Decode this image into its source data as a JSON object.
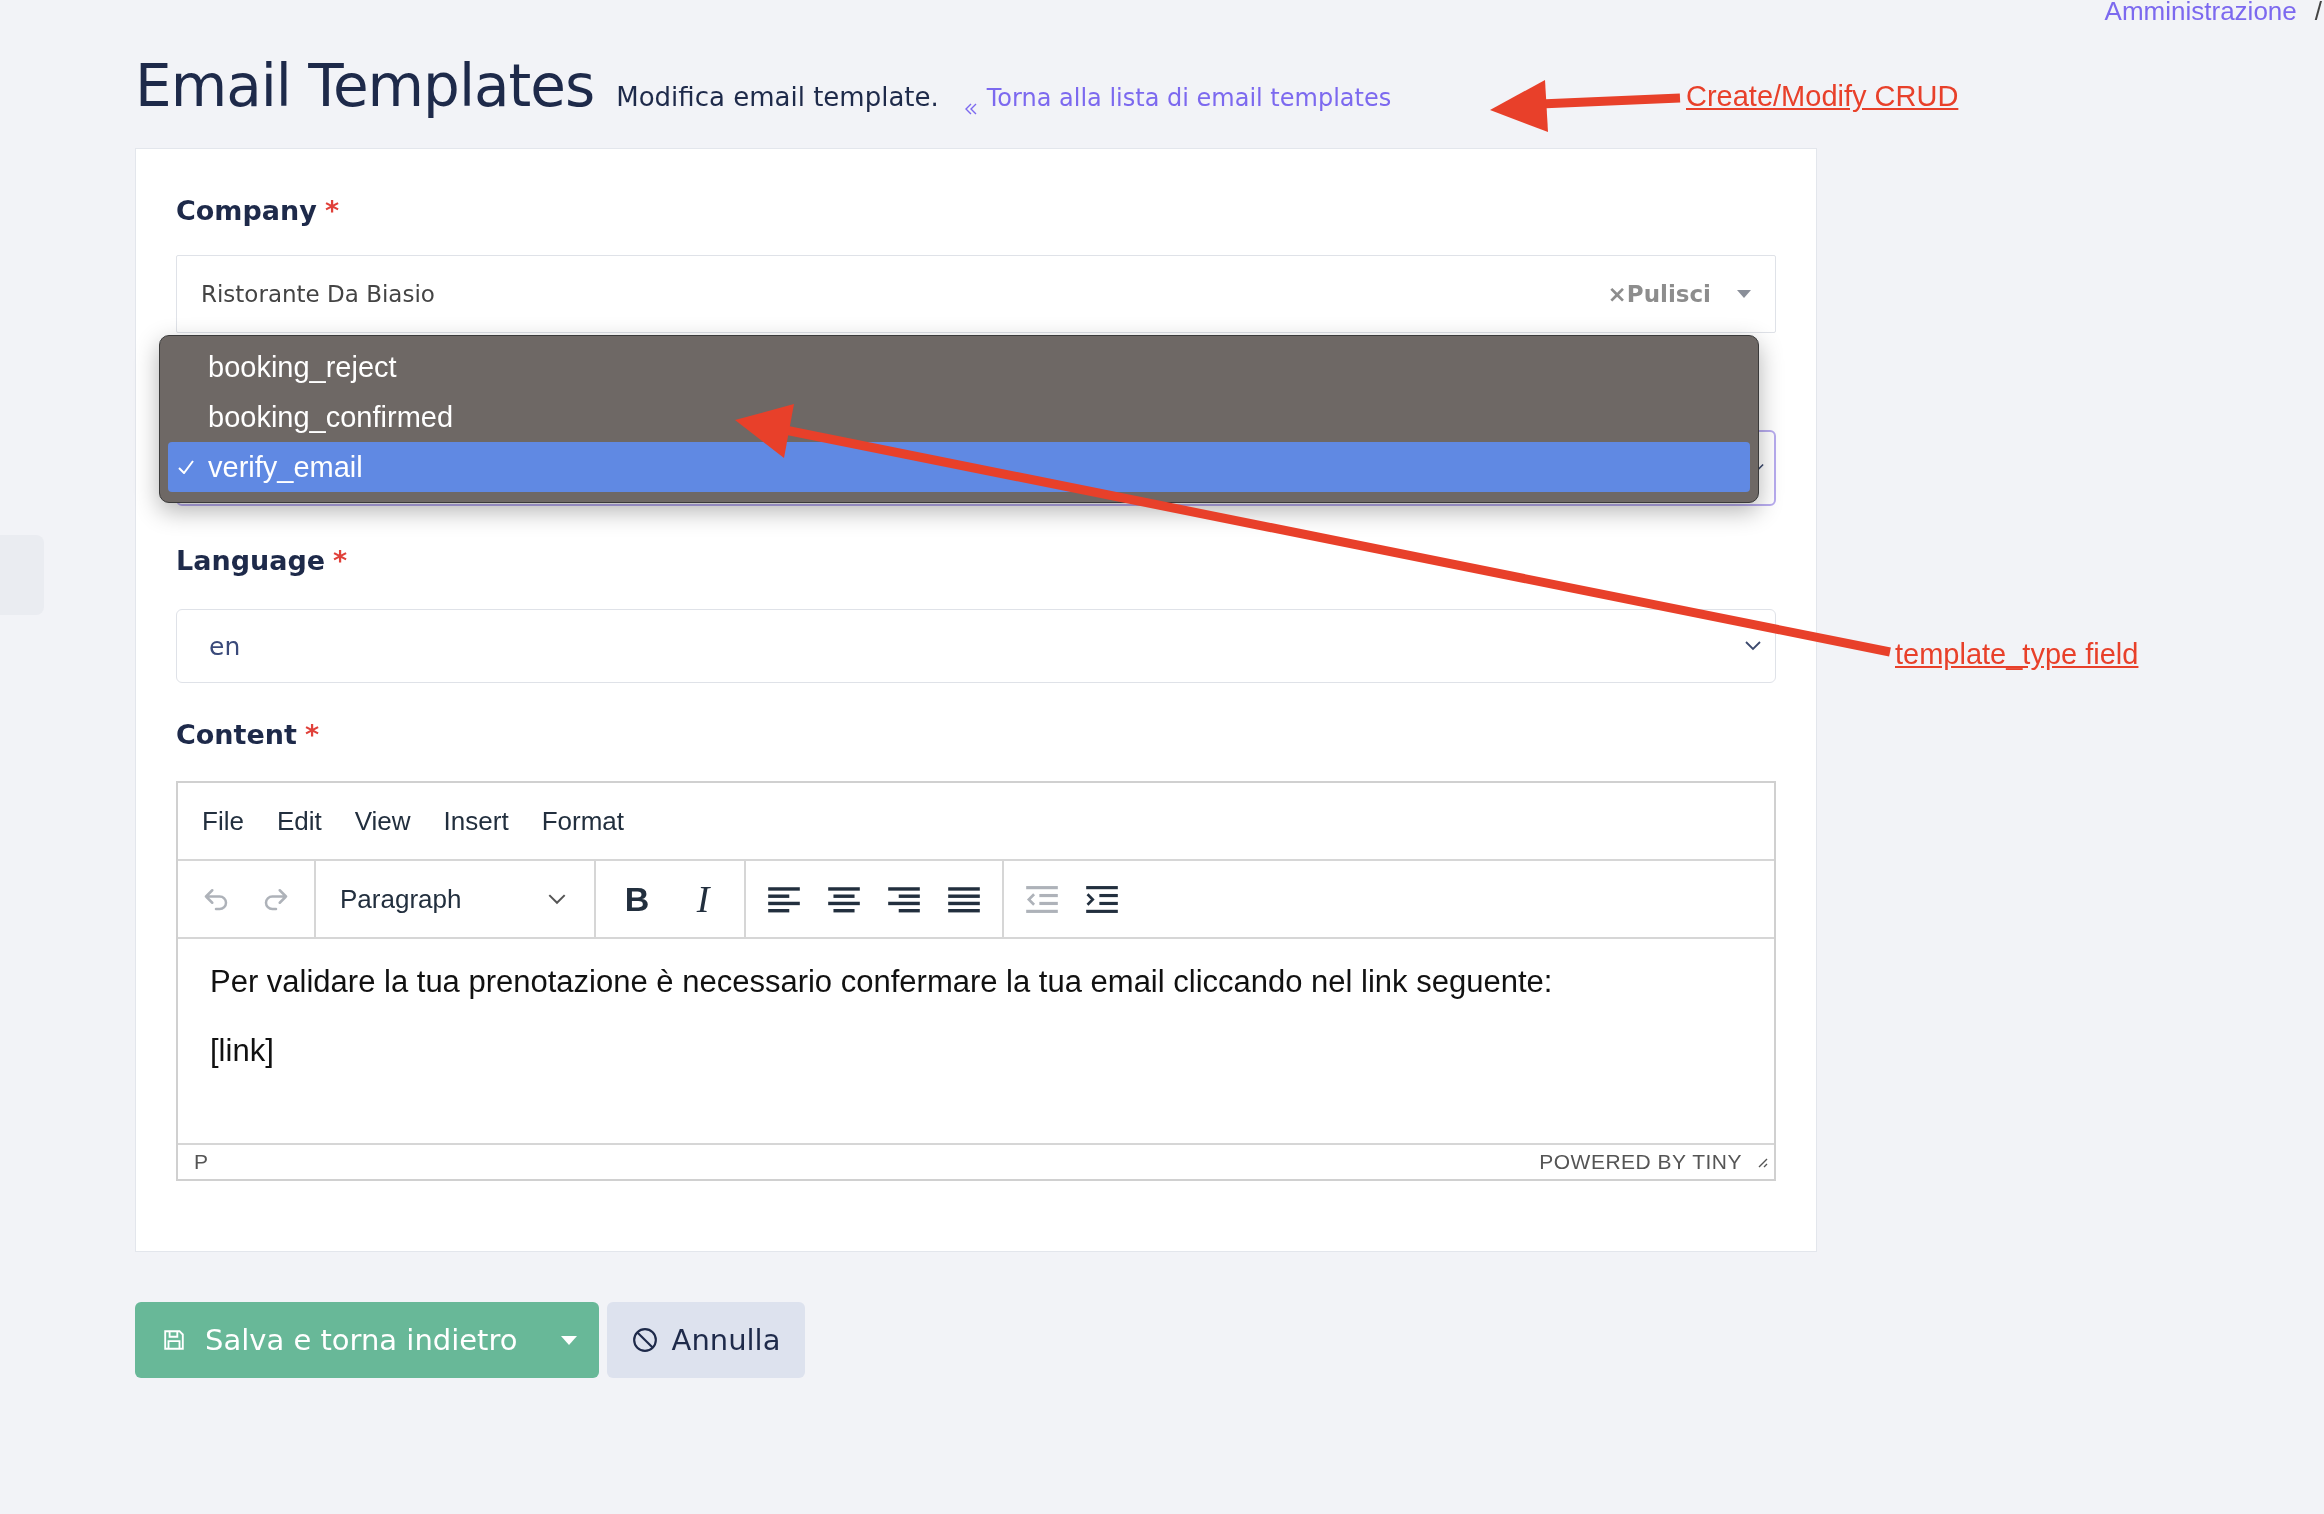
{
  "breadcrumb": {
    "link": "Amministrazione",
    "separator": "/"
  },
  "header": {
    "title": "Email Templates",
    "subtitle": "Modifica email template.",
    "back_link": "Torna alla lista di email templates"
  },
  "form": {
    "company": {
      "label": "Company",
      "required_mark": "*",
      "value": "Ristorante Da Biasio",
      "clear_label": "×Pulisci"
    },
    "template_type": {
      "options": [
        {
          "label": "booking_reject",
          "selected": false
        },
        {
          "label": "booking_confirmed",
          "selected": false
        },
        {
          "label": "verify_email",
          "selected": true
        }
      ]
    },
    "language": {
      "label": "Language",
      "required_mark": "*",
      "value": "en"
    },
    "content": {
      "label": "Content",
      "required_mark": "*",
      "menu": [
        "File",
        "Edit",
        "View",
        "Insert",
        "Format"
      ],
      "toolbar": [
        {
          "kind": "undo",
          "disabled": true
        },
        {
          "kind": "redo",
          "disabled": true
        },
        {
          "kind": "separator"
        },
        {
          "kind": "block",
          "label": "Paragraph"
        },
        {
          "kind": "separator"
        },
        {
          "kind": "bold",
          "label": "B"
        },
        {
          "kind": "italic",
          "label": "I"
        },
        {
          "kind": "separator"
        },
        {
          "kind": "align-left"
        },
        {
          "kind": "align-center"
        },
        {
          "kind": "align-right"
        },
        {
          "kind": "justify"
        },
        {
          "kind": "separator"
        },
        {
          "kind": "outdent",
          "disabled": true
        },
        {
          "kind": "indent",
          "disabled": false
        }
      ],
      "paragraphs": [
        "Per validare la tua prenotazione è necessario confermare la tua email cliccando nel link seguente:",
        "[link]"
      ],
      "status_path": "P",
      "branding": "POWERED BY TINY"
    }
  },
  "actions": {
    "save": "Salva e torna indietro",
    "cancel": "Annulla"
  },
  "annotations": [
    {
      "text": "Create/Modify CRUD"
    },
    {
      "text": "template_type field"
    }
  ]
}
